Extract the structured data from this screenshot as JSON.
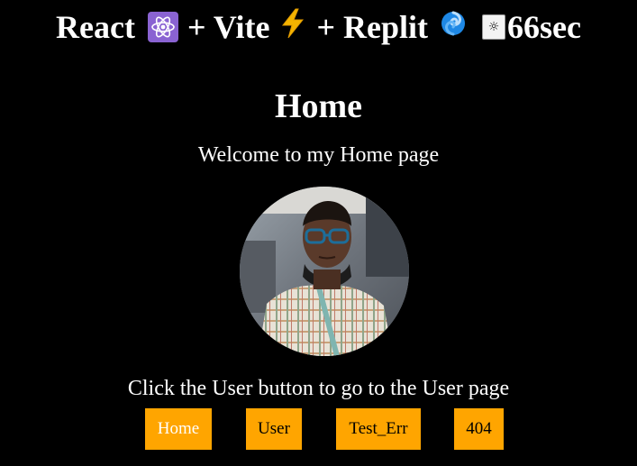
{
  "header": {
    "react_label": "React",
    "plus_vite": "+ Vite",
    "plus_replit": "+ Replit",
    "theme_toggle_glyph": "☼",
    "timer_text": "66sec",
    "icons": [
      "atom-icon",
      "lightning-icon",
      "replit-swirl-icon",
      "sun-icon"
    ]
  },
  "main": {
    "heading": "Home",
    "welcome": "Welcome to my Home page",
    "instructions": "Click the User button to go to the User page"
  },
  "nav": {
    "buttons": [
      {
        "label": "Home",
        "active": true
      },
      {
        "label": "User",
        "active": false
      },
      {
        "label": "Test_Err",
        "active": false
      },
      {
        "label": "404",
        "active": false
      }
    ]
  },
  "colors": {
    "background": "#000000",
    "text": "#ffffff",
    "button_bg": "#ffa500",
    "button_active_text": "#ffffff",
    "button_text": "#000000"
  }
}
